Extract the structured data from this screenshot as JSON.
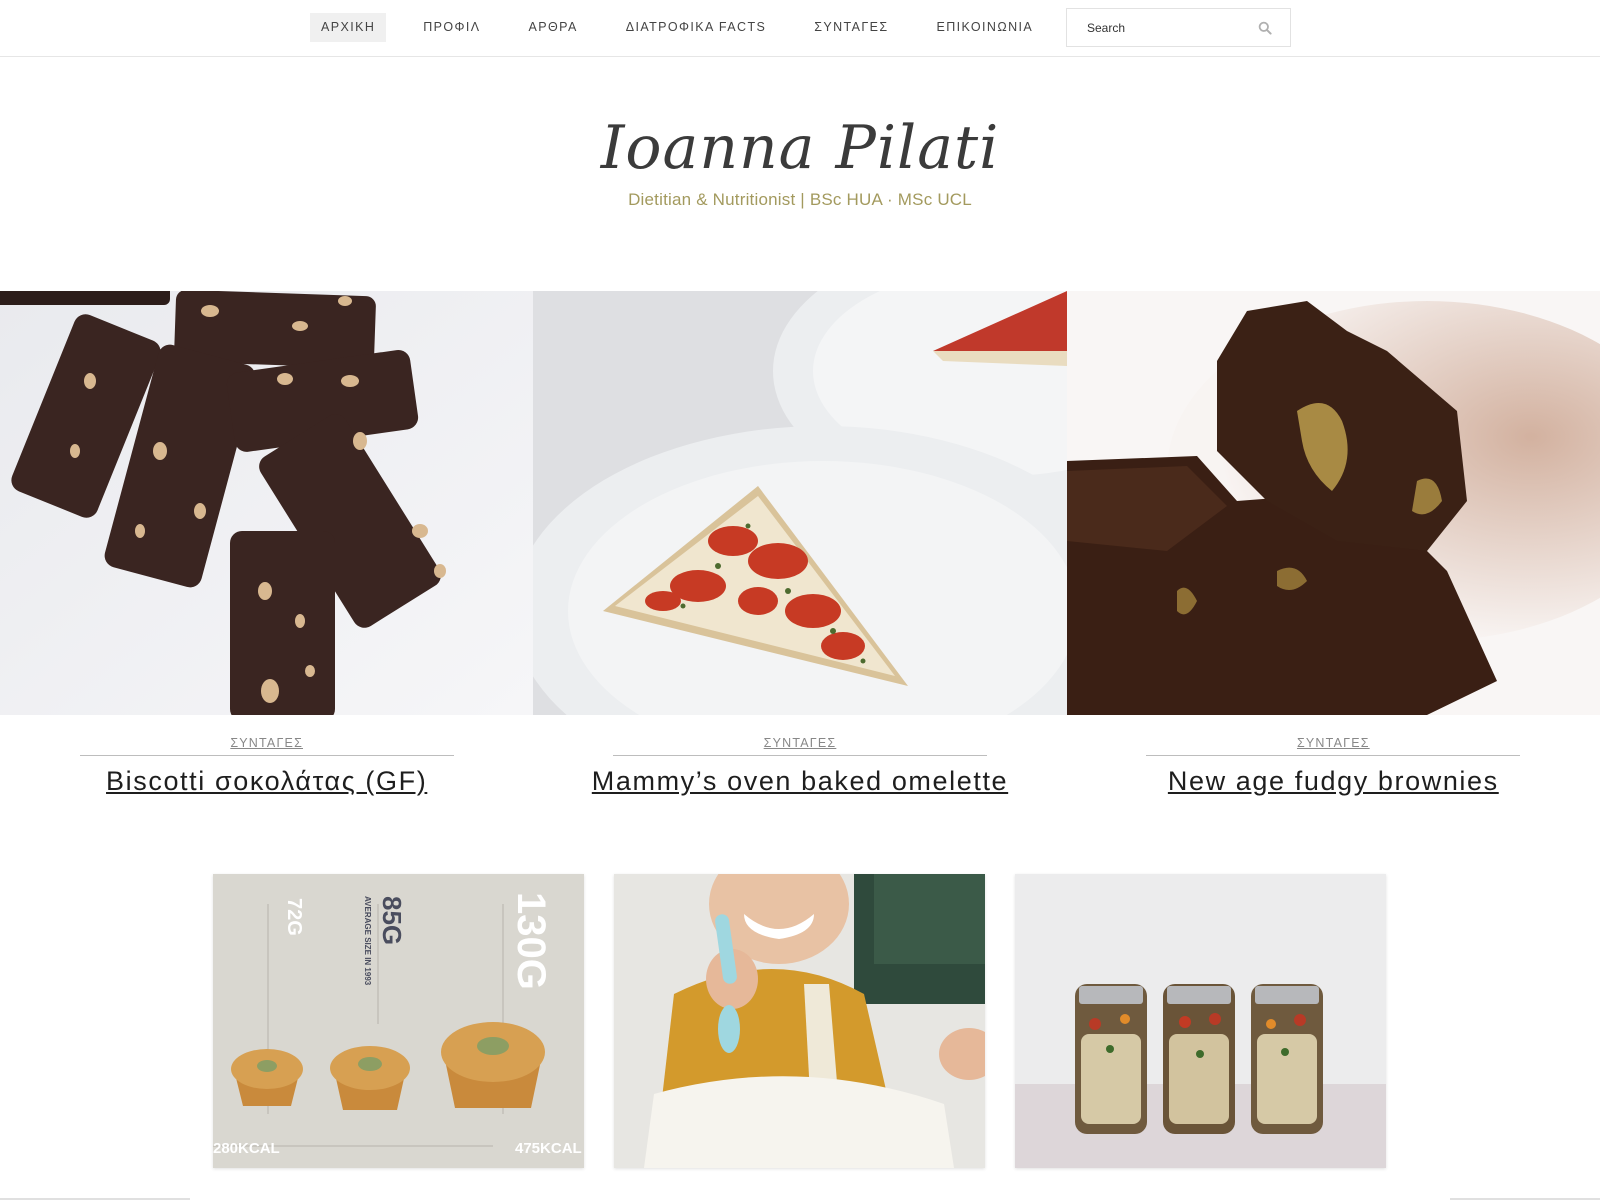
{
  "nav": {
    "items": [
      {
        "label": "ΑΡΧΙΚΗ",
        "active": true
      },
      {
        "label": "ΠΡΟΦΙΛ"
      },
      {
        "label": "ΑΡΘΡΑ"
      },
      {
        "label": "ΔΙΑΤΡΟΦΙΚΑ FACTS"
      },
      {
        "label": "ΣΥΝΤΑΓΕΣ"
      },
      {
        "label": "ΕΠΙΚΟΙΝΩΝΙΑ"
      }
    ],
    "search_placeholder": "Search",
    "search_icon": "search-icon"
  },
  "logo": {
    "name": "Ioanna Pilati",
    "tagline": "Dietitian & Nutritionist | BSc HUA · MSc UCL",
    "tagline_color": "#a39a5e"
  },
  "featured": [
    {
      "category": "ΣΥΝΤΑΓΕΣ",
      "title": "Biscotti σοκολάτας (GF)"
    },
    {
      "category": "ΣΥΝΤΑΓΕΣ",
      "title": "Mammy’s oven baked omelette"
    },
    {
      "category": "ΣΥΝΤΑΓΕΣ",
      "title": "New age fudgy brownies"
    }
  ],
  "cards": {
    "muffins": {
      "label_72": "72G",
      "label_85": "85G",
      "label_avg": "AVERAGE SIZE IN 1993",
      "label_130": "130G",
      "kcal_left": "280KCAL",
      "kcal_right": "475KCAL"
    }
  }
}
